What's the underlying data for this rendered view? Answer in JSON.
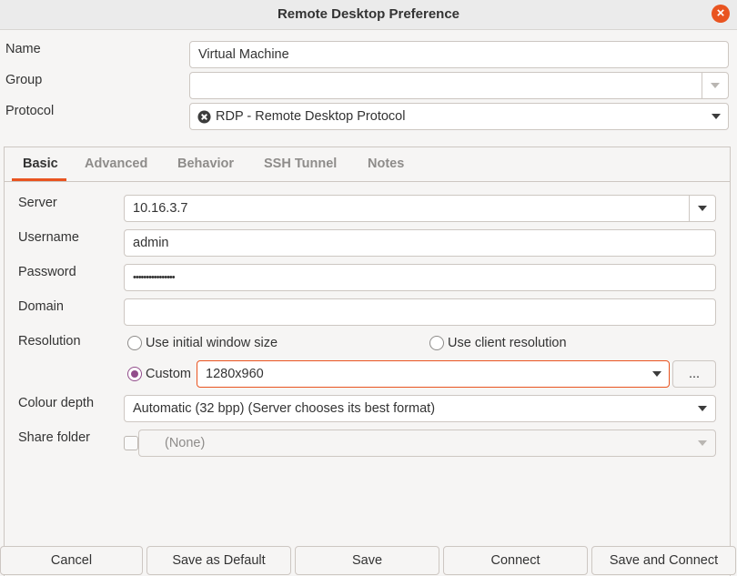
{
  "window": {
    "title": "Remote Desktop Preference",
    "close_glyph": "×"
  },
  "profile": {
    "name_label": "Name",
    "name_value": "Virtual Machine",
    "group_label": "Group",
    "group_value": "",
    "protocol_label": "Protocol",
    "protocol_value": "RDP - Remote Desktop Protocol",
    "protocol_icon": "rdp-protocol-icon"
  },
  "tabs": [
    {
      "label": "Basic",
      "active": true
    },
    {
      "label": "Advanced",
      "active": false
    },
    {
      "label": "Behavior",
      "active": false
    },
    {
      "label": "SSH Tunnel",
      "active": false
    },
    {
      "label": "Notes",
      "active": false
    }
  ],
  "basic": {
    "server_label": "Server",
    "server_value": "10.16.3.7",
    "username_label": "Username",
    "username_value": "admin",
    "password_label": "Password",
    "password_value": "••••••••••••••••",
    "domain_label": "Domain",
    "domain_value": "",
    "resolution_label": "Resolution",
    "resolution_initial": "Use initial window size",
    "resolution_client": "Use client resolution",
    "resolution_custom": "Custom",
    "resolution_selected": "custom",
    "custom_value": "1280x960",
    "more_button": "...",
    "colour_label": "Colour depth",
    "colour_value": "Automatic (32 bpp) (Server chooses its best format)",
    "share_label": "Share folder",
    "share_checked": false,
    "share_value": "(None)"
  },
  "buttons": {
    "cancel": "Cancel",
    "save_default": "Save as Default",
    "save": "Save",
    "connect": "Connect",
    "save_connect": "Save and Connect"
  },
  "colors": {
    "accent": "#e95420",
    "radio": "#924d8b"
  }
}
